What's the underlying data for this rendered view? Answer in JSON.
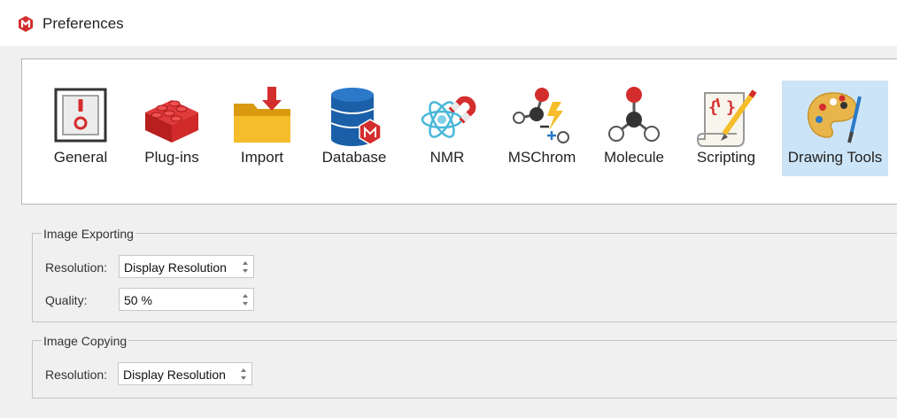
{
  "window": {
    "title": "Preferences"
  },
  "toolbar": {
    "items": [
      {
        "label": "General",
        "icon": "switch-icon",
        "selected": false
      },
      {
        "label": "Plug-ins",
        "icon": "lego-brick-icon",
        "selected": false
      },
      {
        "label": "Import",
        "icon": "import-folder-icon",
        "selected": false
      },
      {
        "label": "Database",
        "icon": "database-icon",
        "selected": false
      },
      {
        "label": "NMR",
        "icon": "atom-magnet-icon",
        "selected": false
      },
      {
        "label": "MSChrom",
        "icon": "ms-molecule-icon",
        "selected": false
      },
      {
        "label": "Molecule",
        "icon": "molecule-icon",
        "selected": false
      },
      {
        "label": "Scripting",
        "icon": "script-scroll-icon",
        "selected": false
      },
      {
        "label": "Drawing Tools",
        "icon": "palette-icon",
        "selected": true
      }
    ]
  },
  "image_exporting": {
    "title": "Image Exporting",
    "resolution_label": "Resolution:",
    "resolution_value": "Display Resolution",
    "quality_label": "Quality:",
    "quality_value": "50 %"
  },
  "image_copying": {
    "title": "Image Copying",
    "resolution_label": "Resolution:",
    "resolution_value": "Display Resolution"
  },
  "colors": {
    "selected_bg": "#cce4f7",
    "brand_red": "#d42d2d",
    "folder_yellow": "#f2b51b",
    "database_blue": "#1a5fa8"
  }
}
